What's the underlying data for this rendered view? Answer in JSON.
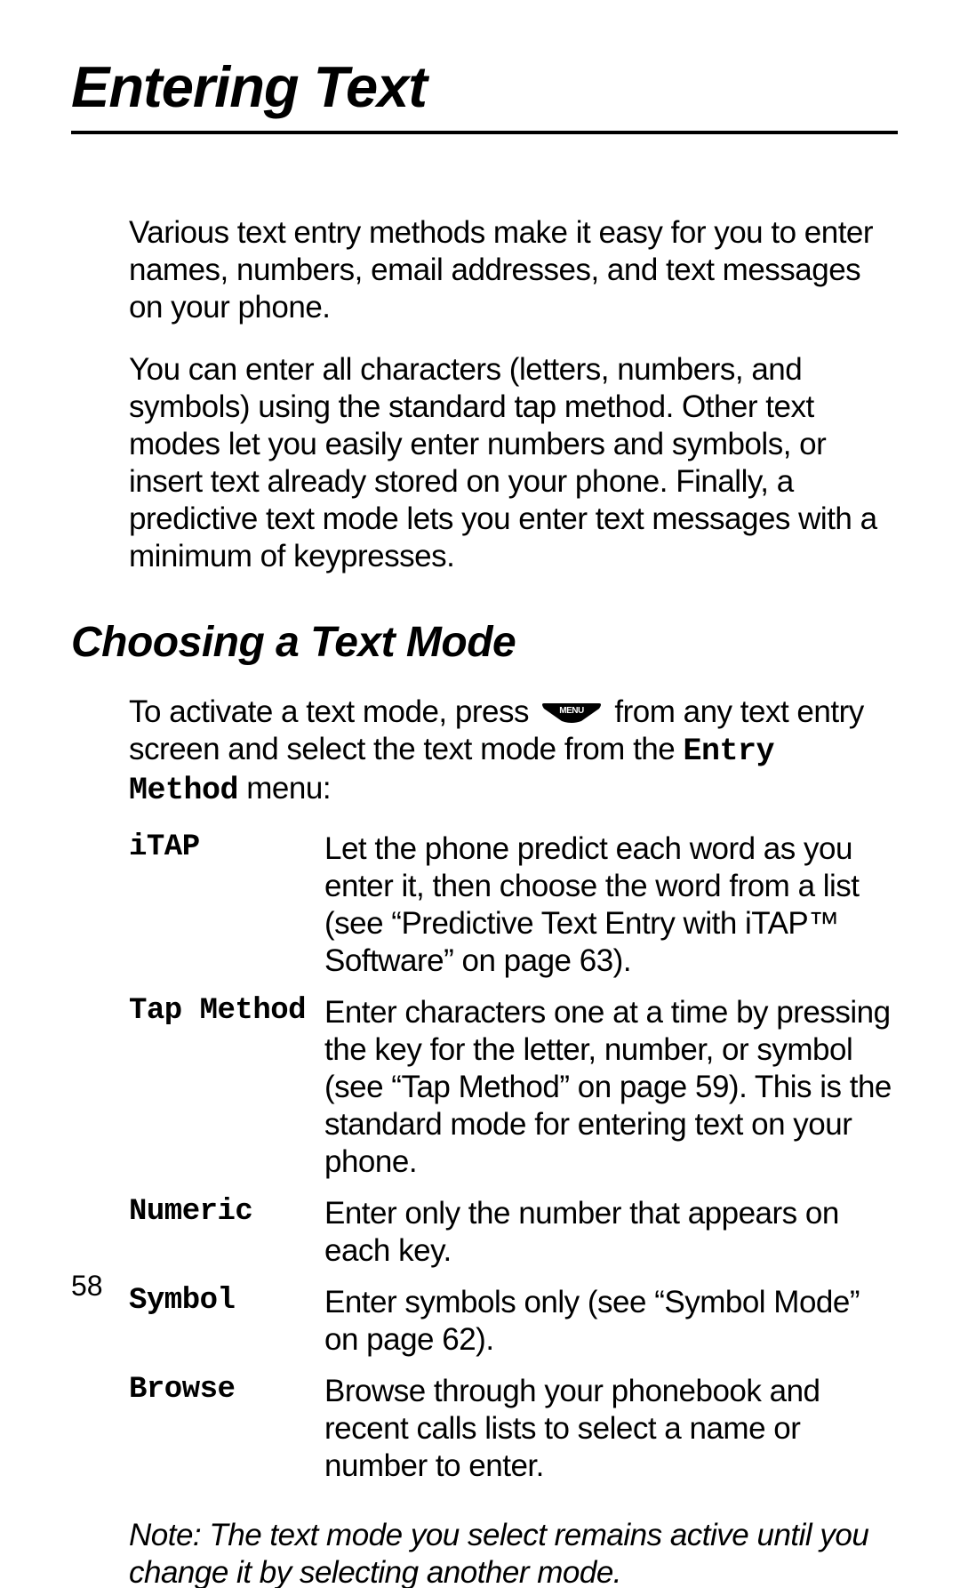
{
  "chapter_title": "Entering Text",
  "intro_para_1": "Various text entry methods make it easy for you to enter names, numbers, email addresses, and text messages on your phone.",
  "intro_para_2": "You can enter all characters (letters, numbers, and symbols) using the standard tap method. Other text modes let you easily enter numbers and symbols, or insert text already stored on your phone. Finally, a predictive text mode lets you enter text messages with a minimum of keypresses.",
  "section_heading": "Choosing a Text Mode",
  "section_body": {
    "prefix": "To activate a text mode, press ",
    "menu_key_label": "MENU",
    "middle": " from any text entry screen and select the text mode from the ",
    "menu_name": "Entry Method",
    "suffix": " menu:"
  },
  "modes": [
    {
      "term": "iTAP",
      "desc": "Let the phone predict each word as you enter it, then choose the word from a list (see “Predictive Text Entry with iTAP™ Software” on page 63)."
    },
    {
      "term": "Tap Method",
      "desc": "Enter characters one at a time by pressing the key for the letter, number, or symbol (see “Tap Method” on page 59). This is the standard mode for entering text on your phone."
    },
    {
      "term": "Numeric",
      "desc": "Enter only the number that appears on each key."
    },
    {
      "term": "Symbol",
      "desc": "Enter symbols only (see “Symbol Mode” on page 62)."
    },
    {
      "term": "Browse",
      "desc": "Browse through your phonebook and recent calls lists to select a name or number to enter."
    }
  ],
  "note": "Note: The text mode you select remains active until you change it by selecting another mode.",
  "page_number": "58"
}
